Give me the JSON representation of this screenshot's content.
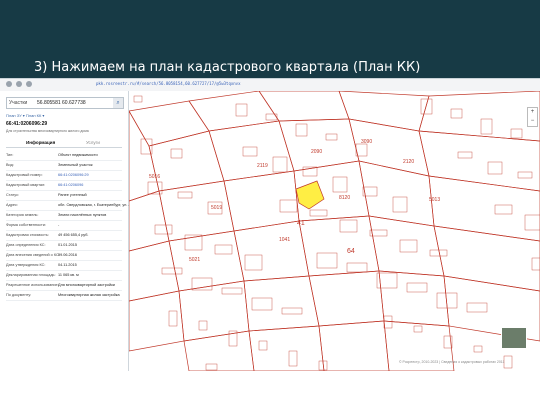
{
  "slide": {
    "title": "3) Нажимаем на план кадастрового квартала (План КК)"
  },
  "browser": {
    "url": "pkk.rosreestr.ru/#/search/56.8058154,60.627727/17/@5w3tqxnvx"
  },
  "panel": {
    "search_type": "Участки",
    "search_value": "56.805581 60.627738",
    "crumbs": "План ЗУ   ▾     План КК   ▾",
    "object_id": "66:41:0206096:29",
    "object_sub": "Для строительства многоквартирного жилого дома",
    "tabs": [
      "Информация",
      "Услуги"
    ],
    "rows": [
      {
        "k": "Тип:",
        "v": "Объект недвижимости"
      },
      {
        "k": "Вид:",
        "v": "Земельный участок"
      },
      {
        "k": "Кадастровый номер:",
        "v": "66:41:0206096:29",
        "link": true
      },
      {
        "k": "Кадастровый квартал:",
        "v": "66:41:0206096",
        "link": true
      },
      {
        "k": "Статус:",
        "v": "Ранее учтенный"
      },
      {
        "k": "Адрес:",
        "v": "обл. Свердловская, г. Екатеринбург, ул. Луначарского"
      },
      {
        "k": "Категория земель:",
        "v": "Земли населённых пунктов"
      },
      {
        "k": "Форма собственности:",
        "v": "-"
      },
      {
        "k": "Кадастровая стоимость:",
        "v": "49 456 655,4 руб."
      },
      {
        "k": "Дата определения КС:",
        "v": "01.01.2015"
      },
      {
        "k": "Дата внесения сведений о КС:",
        "v": "09.06.2016"
      },
      {
        "k": "Дата утверждения КС:",
        "v": "04.11.2015"
      },
      {
        "k": "Декларированная площадь:",
        "v": "11 065 кв. м"
      },
      {
        "k": "Разрешенное использование:",
        "v": "Для многоквартирной застройки"
      },
      {
        "k": "По документу:",
        "v": "Многоквартирная жилая застройка"
      }
    ]
  },
  "map": {
    "labels": [
      "41",
      "64",
      "2090",
      "5016",
      "2119",
      "5019",
      "8120",
      "1041",
      "2120",
      "5021",
      "3090",
      "5013"
    ],
    "footer": "© Росреестр, 2010-2023 | Сведения о кадастровых работах 2011",
    "zoom_in": "+",
    "zoom_out": "−",
    "parcel_color": "#ffee44",
    "line_color": "#c0392b"
  }
}
